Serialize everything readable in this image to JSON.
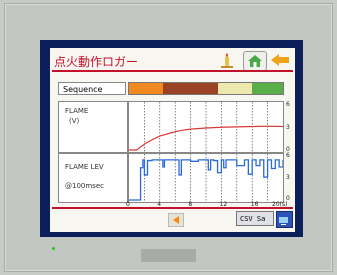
{
  "header": {
    "title": "点火動作ロガー",
    "accent_color": "#c4122a"
  },
  "toolbar": {
    "icons": [
      "candle-icon",
      "home-icon",
      "back-arrow-icon"
    ]
  },
  "sequence": {
    "label": "Sequence",
    "segments": [
      {
        "fraction": 0.22,
        "color": "#f08a20"
      },
      {
        "fraction": 0.36,
        "color": "#9a4226"
      },
      {
        "fraction": 0.22,
        "color": "#ece8ae"
      },
      {
        "fraction": 0.2,
        "color": "#5aae48"
      }
    ]
  },
  "flame_panel": {
    "line1": "FLAME",
    "line2": "(V)"
  },
  "lev_panel": {
    "line1": "FLAME LEV",
    "line2": "@100msec"
  },
  "axes": {
    "x_ticks": [
      "0",
      "4",
      "8",
      "12",
      "16",
      "20(s)"
    ],
    "flame_y_ticks": [
      "6",
      "3",
      "0"
    ],
    "lev_y_ticks": [
      "6",
      "3",
      "0"
    ]
  },
  "footer": {
    "csv_label": "CSV Sa"
  },
  "chart_data": [
    {
      "type": "line",
      "ylabel": "FLAME (V)",
      "ylim": [
        0,
        6
      ],
      "xlim": [
        0,
        20
      ],
      "series": [
        {
          "x": [
            0,
            1,
            1.5,
            2,
            3,
            4,
            5,
            6,
            7,
            8,
            10,
            12,
            14,
            16,
            18,
            20
          ],
          "y": [
            0,
            0,
            0.4,
            0.8,
            1.4,
            1.9,
            2.2,
            2.5,
            2.7,
            2.85,
            3.0,
            3.1,
            3.15,
            3.2,
            3.25,
            3.2
          ]
        }
      ]
    },
    {
      "type": "line",
      "ylabel": "FLAME LEV @100msec",
      "ylim": [
        0,
        6
      ],
      "xlim": [
        0,
        20
      ],
      "series": [
        {
          "x": [
            0,
            1.4,
            1.5,
            1.8,
            2.0,
            2.4,
            3,
            4,
            4.4,
            4.6,
            5,
            6,
            6.5,
            6.8,
            7,
            8,
            9,
            10,
            10.3,
            10.6,
            11,
            11.5,
            12,
            12.3,
            12.6,
            13,
            14,
            15,
            15.5,
            16,
            16.5,
            17,
            17.5,
            18,
            18.5,
            19,
            19.5,
            20
          ],
          "y": [
            0,
            0,
            4.5,
            5.6,
            3.5,
            5.5,
            5.6,
            5.6,
            4.6,
            5.6,
            5.6,
            5.6,
            3.5,
            5.6,
            5.6,
            5.4,
            5.6,
            5.6,
            4.2,
            5.6,
            5.5,
            3.8,
            5.6,
            4.5,
            5.6,
            5.6,
            4.8,
            5.6,
            3.6,
            5.6,
            4.8,
            5.6,
            3.2,
            5.6,
            4.4,
            5.6,
            4.6,
            5.6
          ]
        }
      ]
    }
  ]
}
